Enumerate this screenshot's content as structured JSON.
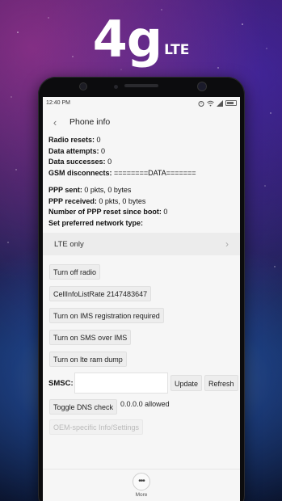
{
  "headline": {
    "main": "4g",
    "suffix": "LTE"
  },
  "status_bar": {
    "time": "12:40 PM",
    "icons": [
      "alarm-icon",
      "wifi-icon",
      "signal-icon",
      "battery-icon"
    ]
  },
  "title_bar": {
    "back_icon": "chevron-left-icon",
    "title": "Phone info"
  },
  "info": {
    "radio_resets_label": "Radio resets:",
    "radio_resets_value": "0",
    "data_attempts_label": "Data attempts:",
    "data_attempts_value": "0",
    "data_successes_label": "Data successes:",
    "data_successes_value": "0",
    "gsm_disconnects_label": "GSM disconnects:",
    "gsm_disconnects_value": "========DATA=======",
    "ppp_sent_label": "PPP sent:",
    "ppp_sent_value": "0 pkts, 0 bytes",
    "ppp_received_label": "PPP received:",
    "ppp_received_value": "0 pkts, 0 bytes",
    "ppp_reset_label": "Number of PPP reset since boot:",
    "ppp_reset_value": "0",
    "preferred_network_label": "Set preferred network type:"
  },
  "network_select": {
    "value": "LTE only"
  },
  "buttons": {
    "turn_off_radio": "Turn off radio",
    "cellinfo_rate": "CellInfoListRate 2147483647",
    "ims_registration": "Turn on IMS registration required",
    "sms_over_ims": "Turn on SMS over IMS",
    "lte_ram_dump": "Turn on lte ram dump",
    "update": "Update",
    "refresh": "Refresh",
    "toggle_dns": "Toggle DNS check",
    "oem_info": "OEM-specific Info/Settings"
  },
  "smsc": {
    "label": "SMSC:",
    "value": ""
  },
  "dns_status": "0.0.0.0 allowed",
  "bottom_bar": {
    "more_label": "More",
    "more_icon": "more-dots-icon"
  }
}
